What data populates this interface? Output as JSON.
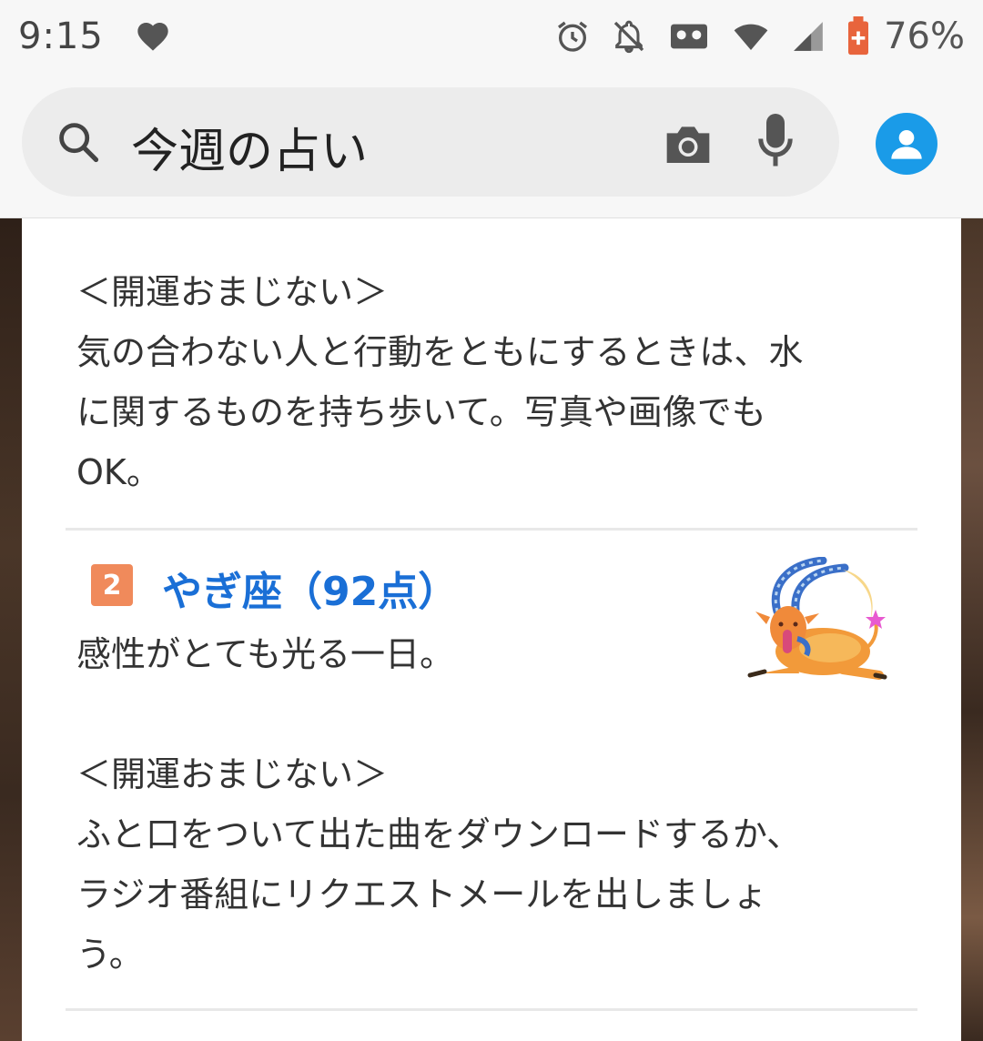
{
  "status_bar": {
    "time": "9:15",
    "battery": "76%",
    "icons": [
      "heart-icon",
      "alarm-icon",
      "notifications-off-icon",
      "voicemail-icon",
      "wifi-icon",
      "signal-icon",
      "battery-icon"
    ]
  },
  "search": {
    "query": "今週の占い",
    "icons": [
      "search-icon",
      "camera-icon",
      "mic-icon",
      "account-icon"
    ]
  },
  "colors": {
    "accent_blue": "#1a6fd6",
    "rank_badge": "#f08a5b",
    "avatar": "#1a9be8"
  },
  "entries": [
    {
      "charm_heading": "＜開運おまじない＞",
      "charm_lines": [
        "気の合わない人と行動をともにするときは、水",
        "に関するものを持ち歩いて。写真や画像でも",
        "OK。"
      ]
    },
    {
      "rank": "2",
      "title": "やぎ座（92点）",
      "summary": "感性がとても光る一日。",
      "image": "capricorn-goat-illustration",
      "charm_heading": "＜開運おまじない＞",
      "charm_lines": [
        "ふと口をついて出た曲をダウンロードするか、",
        "ラジオ番組にリクエストメールを出しましょ",
        "う。"
      ]
    }
  ]
}
